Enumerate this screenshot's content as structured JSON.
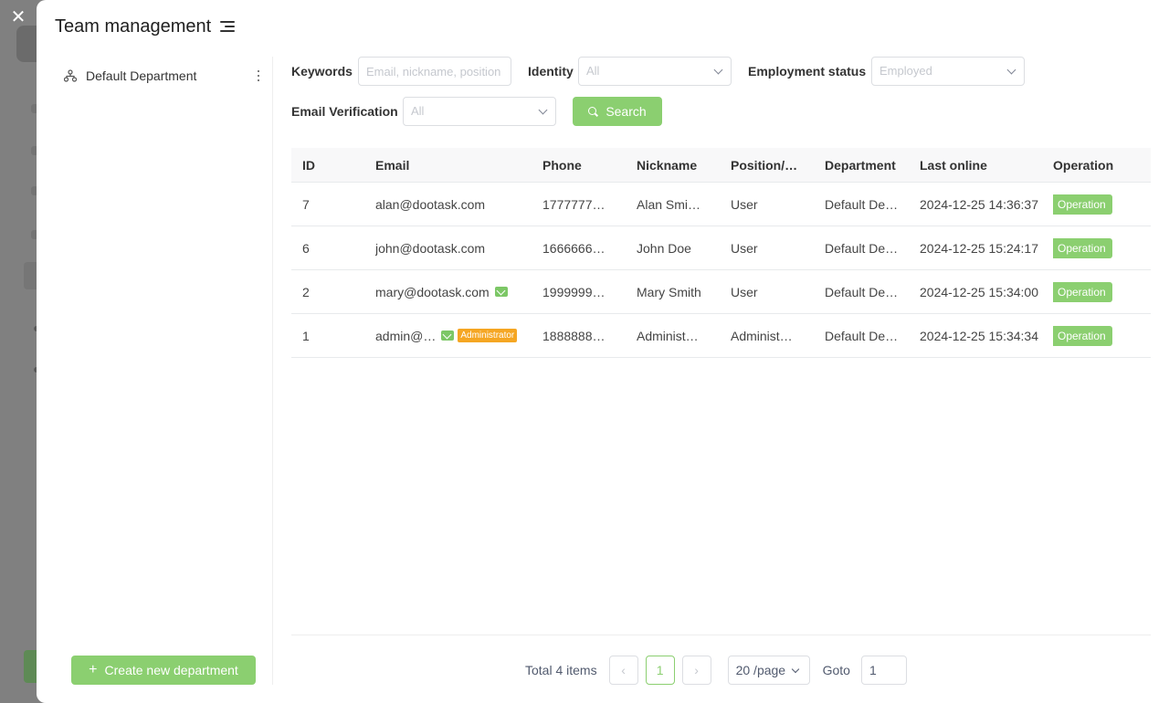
{
  "modal": {
    "title": "Team management",
    "close_icon": "close-icon",
    "menu_icon": "list-menu-icon"
  },
  "departments": {
    "items": [
      {
        "label": "Default Department",
        "icon": "org-tree-icon",
        "more_icon": "more-vertical-icon"
      }
    ],
    "create_label": "Create new department"
  },
  "filters": {
    "keywords_label": "Keywords",
    "keywords_placeholder": "Email, nickname, position",
    "identity_label": "Identity",
    "identity_value": "All",
    "employment_label": "Employment status",
    "employment_value": "Employed",
    "email_verification_label": "Email Verification",
    "email_verification_value": "All",
    "search_label": "Search"
  },
  "table": {
    "columns": [
      "ID",
      "Email",
      "Phone",
      "Nickname",
      "Position/…",
      "Department",
      "Last online",
      "Operation"
    ],
    "rows": [
      {
        "id": "7",
        "email": "alan@dootask.com",
        "verified": false,
        "admin": "",
        "phone": "1777777…",
        "nickname": "Alan Smi…",
        "position": "User",
        "department": "Default De…",
        "last_online": "2024-12-25 14:36:37",
        "operation": "Operation"
      },
      {
        "id": "6",
        "email": "john@dootask.com",
        "verified": false,
        "admin": "",
        "phone": "1666666…",
        "nickname": "John Doe",
        "position": "User",
        "department": "Default De…",
        "last_online": "2024-12-25 15:24:17",
        "operation": "Operation"
      },
      {
        "id": "2",
        "email": "mary@dootask.com",
        "verified": true,
        "admin": "",
        "phone": "1999999…",
        "nickname": "Mary Smith",
        "position": "User",
        "department": "Default De…",
        "last_online": "2024-12-25 15:34:00",
        "operation": "Operation"
      },
      {
        "id": "1",
        "email": "admin@…",
        "verified": true,
        "admin": "Administrator",
        "phone": "1888888…",
        "nickname": "Administ…",
        "position": "Administ…",
        "department": "Default De…",
        "last_online": "2024-12-25 15:34:34",
        "operation": "Operation"
      }
    ]
  },
  "pagination": {
    "total": "Total 4 items",
    "prev": "‹",
    "current": "1",
    "next": "›",
    "page_size": "20 /page",
    "goto_label": "Goto",
    "goto_value": "1"
  },
  "colors": {
    "accent": "#8bcf70",
    "admin_badge": "#f5a623",
    "mail_verified": "#7cc766"
  }
}
